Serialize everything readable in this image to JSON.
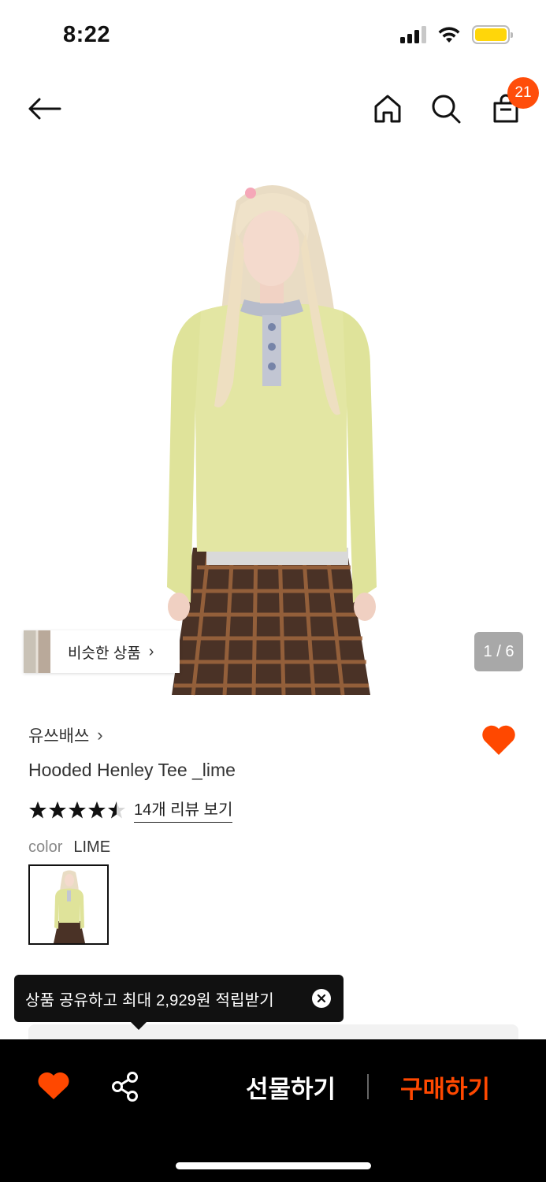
{
  "status_bar": {
    "time": "8:22",
    "icons": [
      "signal-icon",
      "wifi-icon",
      "battery-icon"
    ]
  },
  "nav": {
    "icons": [
      "back-arrow-icon",
      "home-icon",
      "search-icon",
      "shopping-bag-icon"
    ],
    "cart_count": "21"
  },
  "gallery": {
    "similar_label": "비슷한 상품",
    "page_indicator": "1 / 6"
  },
  "product": {
    "brand": "유쓰배쓰",
    "name": "Hooded Henley Tee _lime",
    "rating": 4.5,
    "rating_max": 5,
    "review_link": "14개 리뷰 보기",
    "color_label": "color",
    "color_value": "LIME",
    "wishlisted": true
  },
  "tooltip": {
    "text": "상품 공유하고 최대 2,929원 적립받기"
  },
  "actions": {
    "gift": "선물하기",
    "buy": "구매하기"
  },
  "colors": {
    "accent": "#ff4800",
    "badge": "#ff4d0a",
    "battery": "#ffd60a",
    "text_dark": "#222222",
    "tooltip_bg": "#111111",
    "bar_bg": "#000000"
  }
}
